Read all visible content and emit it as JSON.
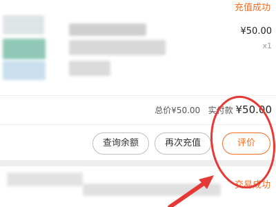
{
  "order1": {
    "status": "充值成功",
    "price": "¥50.00",
    "quantity": "x1",
    "summary": {
      "total_label": "总价",
      "total_value": "¥50.00",
      "paid_label": "实付款",
      "paid_value": "¥50.00"
    },
    "actions": {
      "check_balance": "查询余额",
      "recharge_again": "再次充值",
      "review": "评价"
    }
  },
  "order2": {
    "status": "交易成功"
  },
  "annotation": {
    "color": "#e53935"
  },
  "accent_color": "#f26d21"
}
